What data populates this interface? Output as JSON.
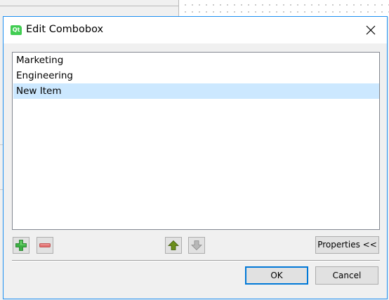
{
  "dialog": {
    "title": "Edit Combobox",
    "app_icon_text": "Qt"
  },
  "list": {
    "items": [
      {
        "label": "Marketing",
        "selected": false
      },
      {
        "label": "Engineering",
        "selected": false
      },
      {
        "label": "New Item",
        "selected": true
      }
    ]
  },
  "toolbar": {
    "add_icon": "plus-icon",
    "remove_icon": "minus-icon",
    "move_up_icon": "arrow-up-icon",
    "move_down_icon": "arrow-down-icon",
    "properties_label": "Properties <<"
  },
  "buttons": {
    "ok_label": "OK",
    "cancel_label": "Cancel"
  },
  "colors": {
    "accent": "#0078d7",
    "selection": "#cce8ff",
    "add_green": "#3cb043",
    "remove_red": "#e06b6b",
    "arrow_up": "#6b8e1a",
    "arrow_disabled": "#a8a8a8"
  }
}
